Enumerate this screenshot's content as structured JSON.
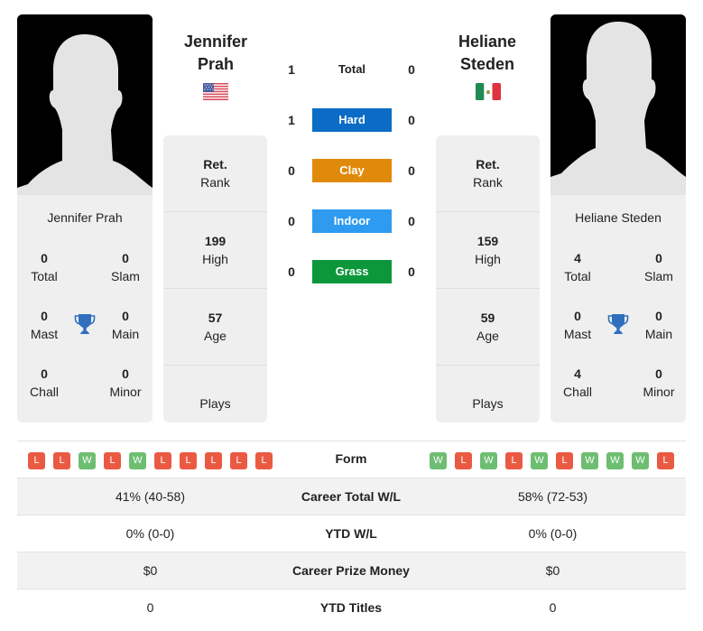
{
  "player_left": {
    "name_line1": "Jennifer",
    "name_line2": "Prah",
    "full_name": "Jennifer Prah",
    "flag": "usa-flag",
    "titles": {
      "total": "0",
      "slam": "0",
      "mast": "0",
      "main": "0",
      "chall": "0",
      "minor": "0"
    },
    "info": {
      "rank_value": "Ret.",
      "rank_label": "Rank",
      "high_value": "199",
      "high_label": "High",
      "age_value": "57",
      "age_label": "Age",
      "plays_label": "Plays"
    },
    "form": [
      "L",
      "L",
      "W",
      "L",
      "W",
      "L",
      "L",
      "L",
      "L",
      "L"
    ]
  },
  "player_right": {
    "name_line1": "Heliane",
    "name_line2": "Steden",
    "full_name": "Heliane Steden",
    "flag": "mexico-flag",
    "titles": {
      "total": "4",
      "slam": "0",
      "mast": "0",
      "main": "0",
      "chall": "4",
      "minor": "0"
    },
    "info": {
      "rank_value": "Ret.",
      "rank_label": "Rank",
      "high_value": "159",
      "high_label": "High",
      "age_value": "59",
      "age_label": "Age",
      "plays_label": "Plays"
    },
    "form": [
      "W",
      "L",
      "W",
      "L",
      "W",
      "L",
      "W",
      "W",
      "W",
      "L"
    ]
  },
  "title_labels": {
    "total": "Total",
    "slam": "Slam",
    "mast": "Mast",
    "main": "Main",
    "chall": "Chall",
    "minor": "Minor"
  },
  "head_to_head": [
    {
      "label": "Total",
      "left": "1",
      "right": "0",
      "color": ""
    },
    {
      "label": "Hard",
      "left": "1",
      "right": "0",
      "color": "#0a6cc4"
    },
    {
      "label": "Clay",
      "left": "0",
      "right": "0",
      "color": "#e08a0b"
    },
    {
      "label": "Indoor",
      "left": "0",
      "right": "0",
      "color": "#2e9bf0"
    },
    {
      "label": "Grass",
      "left": "0",
      "right": "0",
      "color": "#0c973a"
    }
  ],
  "form_label": "Form",
  "comparison": [
    {
      "label": "Career Total W/L",
      "left": "41% (40-58)",
      "right": "58% (72-53)"
    },
    {
      "label": "YTD W/L",
      "left": "0% (0-0)",
      "right": "0% (0-0)"
    },
    {
      "label": "Career Prize Money",
      "left": "$0",
      "right": "$0"
    },
    {
      "label": "YTD Titles",
      "left": "0",
      "right": "0"
    }
  ]
}
